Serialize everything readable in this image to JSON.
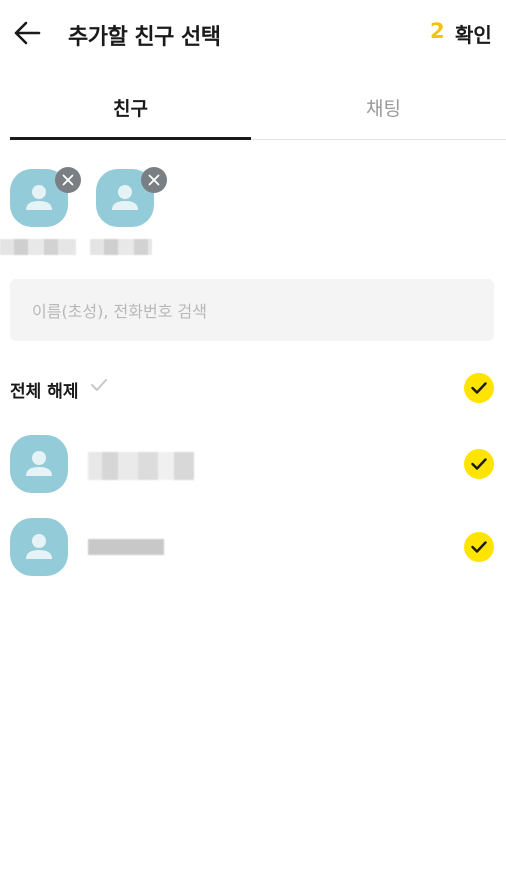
{
  "header": {
    "title": "추가할 친구 선택",
    "selected_count": "2",
    "confirm_label": "확인",
    "back_icon": "arrow-left-icon"
  },
  "tabs": [
    {
      "label": "친구",
      "active": true
    },
    {
      "label": "채팅",
      "active": false
    }
  ],
  "selected": [
    {
      "name": "",
      "avatar": "default-person-avatar"
    },
    {
      "name": "",
      "avatar": "default-person-avatar"
    }
  ],
  "search": {
    "placeholder": "이름(초성), 전화번호 검색",
    "value": ""
  },
  "deselect_all": {
    "label": "전체 해제",
    "checked": true
  },
  "friends": [
    {
      "name": "",
      "checked": true
    },
    {
      "name": "",
      "checked": true
    }
  ],
  "colors": {
    "accent": "#ffe400",
    "count": "#f5c400",
    "avatar_bg": "#93ccd8",
    "remove_badge": "#7a7f84",
    "tab_inactive": "#9a9a9a",
    "search_bg": "#f4f4f4"
  }
}
